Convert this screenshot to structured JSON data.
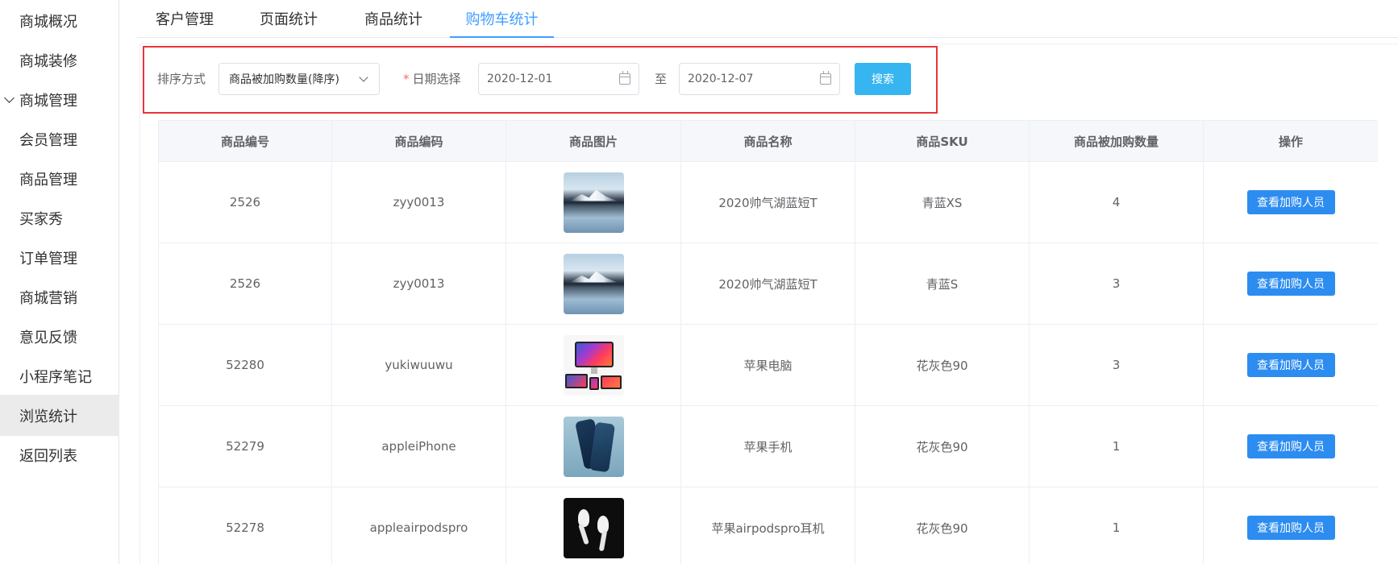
{
  "sidebar": {
    "items": [
      {
        "label": "商城概况"
      },
      {
        "label": "商城装修"
      },
      {
        "label": "商城管理"
      },
      {
        "label": "会员管理"
      },
      {
        "label": "商品管理"
      },
      {
        "label": "买家秀"
      },
      {
        "label": "订单管理"
      },
      {
        "label": "商城营销"
      },
      {
        "label": "意见反馈"
      },
      {
        "label": "小程序笔记"
      },
      {
        "label": "浏览统计"
      },
      {
        "label": "返回列表"
      }
    ],
    "expanded_item": "商城管理",
    "active_item": "浏览统计"
  },
  "tabs": [
    {
      "label": "客户管理"
    },
    {
      "label": "页面统计"
    },
    {
      "label": "商品统计"
    },
    {
      "label": "购物车统计"
    }
  ],
  "active_tab": "购物车统计",
  "filter": {
    "sort_label": "排序方式",
    "sort_value": "商品被加购数量(降序)",
    "date_required_mark": "*",
    "date_label": "日期选择",
    "start_date": "2020-12-01",
    "separator": "至",
    "end_date": "2020-12-07",
    "search_button": "搜索"
  },
  "table": {
    "headers": [
      "商品编号",
      "商品编码",
      "商品图片",
      "商品名称",
      "商品SKU",
      "商品被加购数量",
      "操作"
    ],
    "rows": [
      {
        "id": "2526",
        "code": "zyy0013",
        "image": "lake-landscape",
        "name": "2020帅气湖蓝短T",
        "sku": "青蓝XS",
        "count": "4",
        "action": "查看加购人员"
      },
      {
        "id": "2526",
        "code": "zyy0013",
        "image": "lake-landscape",
        "name": "2020帅气湖蓝短T",
        "sku": "青蓝S",
        "count": "3",
        "action": "查看加购人员"
      },
      {
        "id": "52280",
        "code": "yukiwuuwu",
        "image": "apple-devices",
        "name": "苹果电脑",
        "sku": "花灰色90",
        "count": "3",
        "action": "查看加购人员"
      },
      {
        "id": "52279",
        "code": "appleiPhone",
        "image": "iphone",
        "name": "苹果手机",
        "sku": "花灰色90",
        "count": "1",
        "action": "查看加购人员"
      },
      {
        "id": "52278",
        "code": "appleairpodspro",
        "image": "airpods-pro",
        "name": "苹果airpodspro耳机",
        "sku": "花灰色90",
        "count": "1",
        "action": "查看加购人员"
      }
    ]
  },
  "colors": {
    "accent": "#409eff",
    "search_button": "#36b5f0",
    "action_button": "#2d8cf0",
    "highlight_border": "#e8353a"
  }
}
